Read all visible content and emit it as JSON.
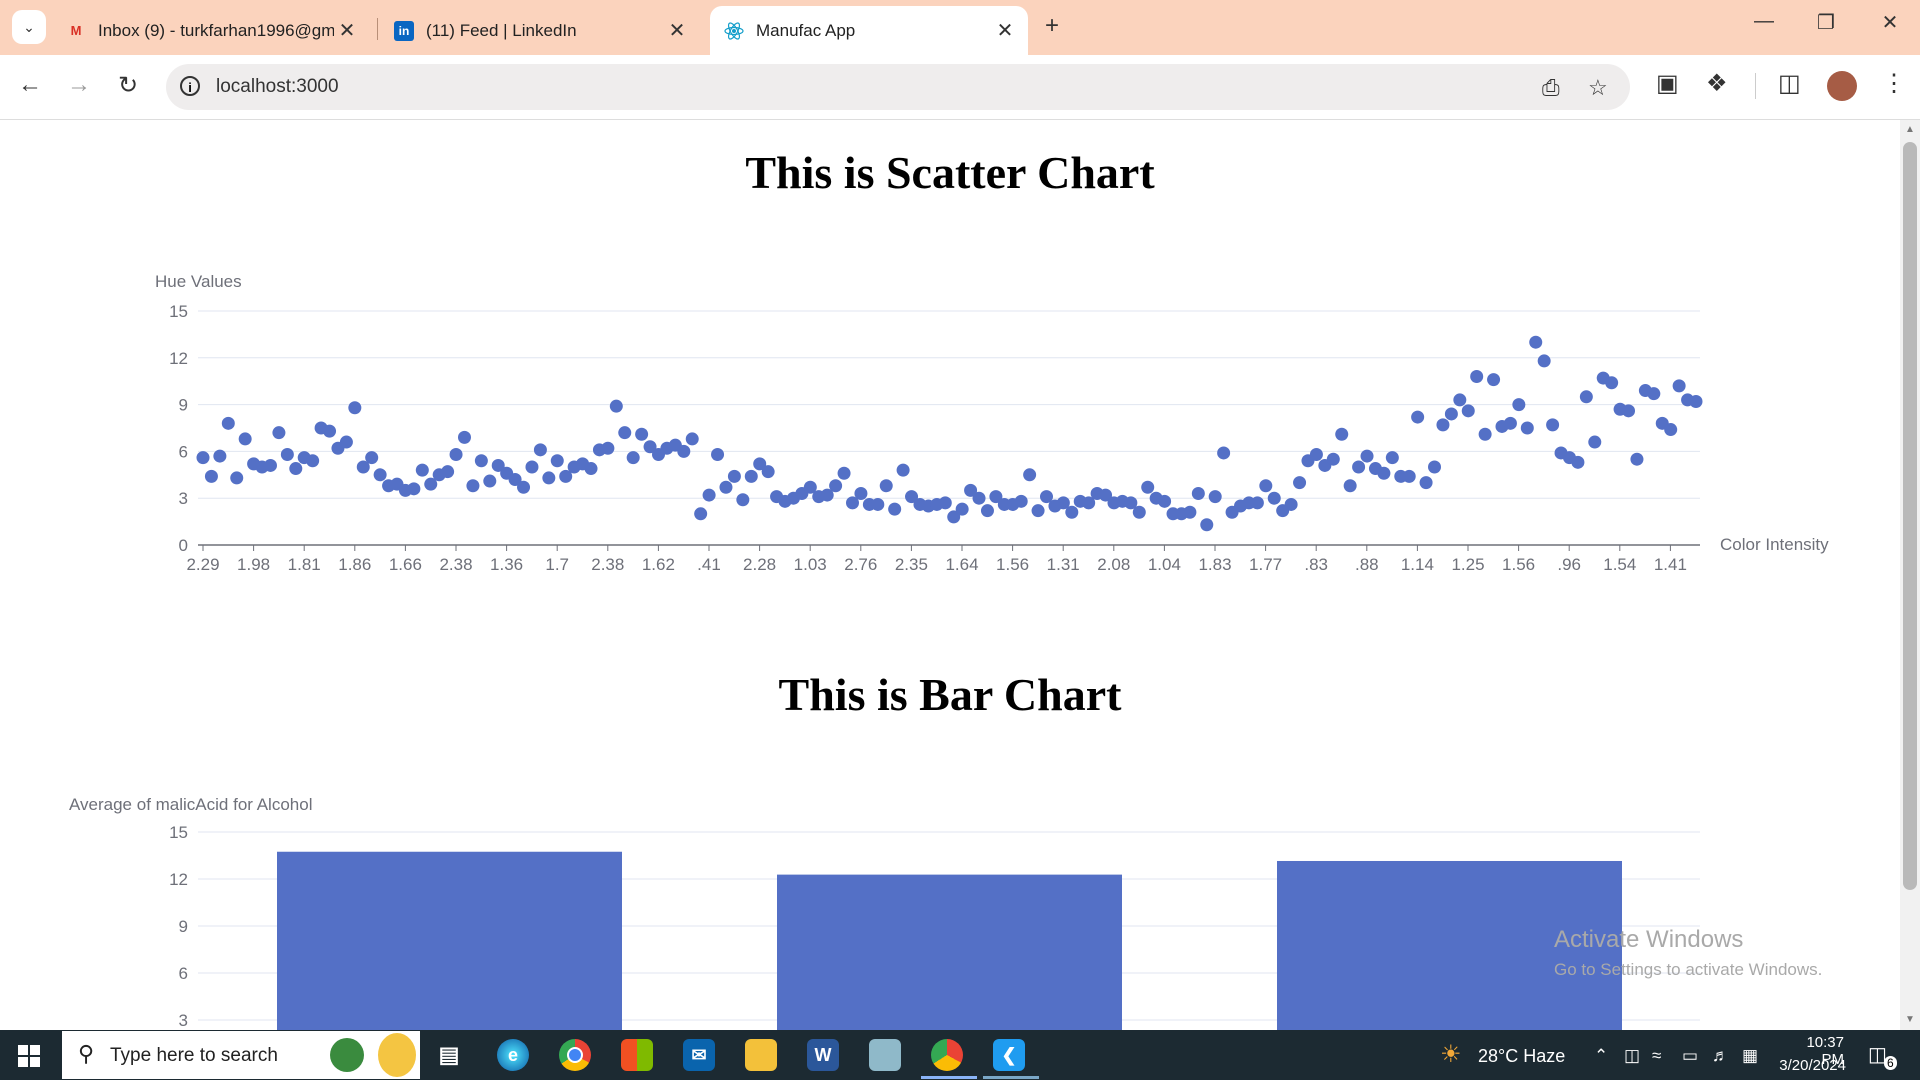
{
  "browser": {
    "tabs": [
      {
        "title": "Inbox (9) - turkfarhan1996@gmail.com",
        "favicon": "gmail-icon"
      },
      {
        "title": "(11) Feed | LinkedIn",
        "favicon": "linkedin-icon"
      },
      {
        "title": "Manufac App",
        "favicon": "react-icon",
        "active": true
      }
    ],
    "new_tab_label": "+",
    "url": "localhost:3000"
  },
  "page": {
    "scatter_title": "This is Scatter Chart",
    "bar_title": "This is Bar Chart",
    "watermark_line1": "Activate Windows",
    "watermark_line2": "Go to Settings to activate Windows."
  },
  "chart_data": [
    {
      "type": "scatter",
      "title": "This is Scatter Chart",
      "xlabel": "Color Intensity",
      "ylabel": "Hue Values",
      "ylim": [
        0,
        15
      ],
      "yticks": [
        0,
        3,
        6,
        9,
        12,
        15
      ],
      "xtick_labels": [
        "2.29",
        "1.98",
        "1.81",
        "1.86",
        "1.66",
        "2.38",
        "1.36",
        "1.7",
        "2.38",
        "1.62",
        ".41",
        "2.28",
        "1.03",
        "2.76",
        "2.35",
        "1.64",
        "1.56",
        "1.31",
        "2.08",
        "1.04",
        "1.83",
        "1.77",
        ".83",
        ".88",
        "1.14",
        "1.25",
        "1.56",
        ".96",
        "1.54",
        "1.41"
      ],
      "y": [
        5.6,
        4.4,
        5.7,
        7.8,
        4.3,
        6.8,
        5.2,
        5.0,
        5.1,
        7.2,
        5.8,
        4.9,
        5.6,
        5.4,
        7.5,
        7.3,
        6.2,
        6.6,
        8.8,
        5.0,
        5.6,
        4.5,
        3.8,
        3.9,
        3.5,
        3.6,
        4.8,
        3.9,
        4.5,
        4.7,
        5.8,
        6.9,
        3.8,
        5.4,
        4.1,
        5.1,
        4.6,
        4.2,
        3.7,
        5.0,
        6.1,
        4.3,
        5.4,
        4.4,
        5.0,
        5.2,
        4.9,
        6.1,
        6.2,
        8.9,
        7.2,
        5.6,
        7.1,
        6.3,
        5.8,
        6.2,
        6.4,
        6.0,
        6.8,
        2.0,
        3.2,
        5.8,
        3.7,
        4.4,
        2.9,
        4.4,
        5.2,
        4.7,
        3.1,
        2.8,
        3.0,
        3.3,
        3.7,
        3.1,
        3.2,
        3.8,
        4.6,
        2.7,
        3.3,
        2.6,
        2.6,
        3.8,
        2.3,
        4.8,
        3.1,
        2.6,
        2.5,
        2.6,
        2.7,
        1.8,
        2.3,
        3.5,
        3.0,
        2.2,
        3.1,
        2.6,
        2.6,
        2.8,
        4.5,
        2.2,
        3.1,
        2.5,
        2.7,
        2.1,
        2.8,
        2.7,
        3.3,
        3.2,
        2.7,
        2.8,
        2.7,
        2.1,
        3.7,
        3.0,
        2.8,
        2.0,
        2.0,
        2.1,
        3.3,
        1.3,
        3.1,
        5.9,
        2.1,
        2.5,
        2.7,
        2.7,
        3.8,
        3.0,
        2.2,
        2.6,
        4.0,
        5.4,
        5.8,
        5.1,
        5.5,
        7.1,
        3.8,
        5.0,
        5.7,
        4.9,
        4.6,
        5.6,
        4.4,
        4.4,
        8.2,
        4.0,
        5.0,
        7.7,
        8.4,
        9.3,
        8.6,
        10.8,
        7.1,
        10.6,
        7.6,
        7.8,
        9.0,
        7.5,
        13.0,
        11.8,
        7.7,
        5.9,
        5.6,
        5.3,
        9.5,
        6.6,
        10.7,
        10.4,
        8.7,
        8.6,
        5.5,
        9.9,
        9.7,
        7.8,
        7.4,
        10.2,
        9.3,
        9.2
      ]
    },
    {
      "type": "bar",
      "title": "This is Bar Chart",
      "ylabel": "Average of malicAcid for Alcohol",
      "ylim": [
        0,
        15
      ],
      "yticks": [
        3,
        6,
        9,
        12,
        15
      ],
      "values": [
        13.74,
        12.28,
        13.15
      ],
      "color": "#5470c6"
    }
  ],
  "taskbar": {
    "search_placeholder": "Type here to search",
    "weather": "28°C  Haze",
    "time": "10:37 PM",
    "date": "3/20/2024",
    "notifications": "6"
  }
}
